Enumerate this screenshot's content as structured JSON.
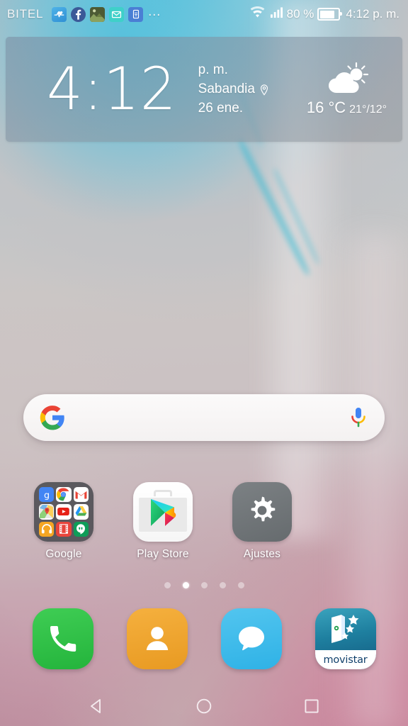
{
  "status_bar": {
    "carrier": "BITEL",
    "notification_icons": [
      {
        "name": "health-icon",
        "label": "Health"
      },
      {
        "name": "facebook-icon",
        "label": "f"
      },
      {
        "name": "photo-icon",
        "label": "Photo"
      },
      {
        "name": "mail-icon",
        "label": "Mail"
      },
      {
        "name": "app-icon",
        "label": "App"
      }
    ],
    "overflow": "…",
    "wifi_icon": "wifi-icon",
    "signal_icon": "cellular-signal-icon",
    "battery_percent": "80 %",
    "battery_level": 80,
    "battery_icon": "battery-icon",
    "time": "4:12 p. m."
  },
  "widget": {
    "time": "4:12",
    "meridiem": "p. m.",
    "location": "Sabandia",
    "location_icon": "location-pin-icon",
    "date": "26 ene.",
    "weather_icon": "partly-cloudy-icon",
    "temperature": "16 °C",
    "high_low": "21°/12°"
  },
  "search": {
    "value": "",
    "placeholder": "",
    "google_logo": "google-g-icon",
    "mic_icon": "microphone-icon"
  },
  "apps": [
    {
      "label": "Google",
      "icon": "google-folder-icon",
      "type": "folder"
    },
    {
      "label": "Play Store",
      "icon": "play-store-icon",
      "type": "app"
    },
    {
      "label": "Ajustes",
      "icon": "settings-gear-icon",
      "type": "app"
    }
  ],
  "folder_contents": [
    "google-search-icon",
    "chrome-icon",
    "gmail-icon",
    "maps-icon",
    "youtube-icon",
    "drive-icon",
    "play-music-icon",
    "play-movies-icon",
    "hangouts-icon"
  ],
  "page_indicator": {
    "total": 5,
    "active_index": 1
  },
  "dock": [
    {
      "label": "Phone",
      "icon": "phone-icon",
      "color": "#2fc24a"
    },
    {
      "label": "Contacts",
      "icon": "contacts-icon",
      "color": "#f0a52f"
    },
    {
      "label": "Messages",
      "icon": "messages-icon",
      "color": "#3fbcec"
    },
    {
      "label": "movistar",
      "icon": "movistar-icon",
      "color": "#1e7f9f"
    }
  ],
  "nav_bar": [
    {
      "label": "Back",
      "icon": "back-triangle-icon"
    },
    {
      "label": "Home",
      "icon": "home-circle-icon"
    },
    {
      "label": "Recents",
      "icon": "recents-square-icon"
    }
  ],
  "colors": {
    "accent_cyan": "#3ec0dd",
    "accent_pink": "#c890a4",
    "status_text": "#ffffff",
    "folder_bg": "#3e4146"
  }
}
